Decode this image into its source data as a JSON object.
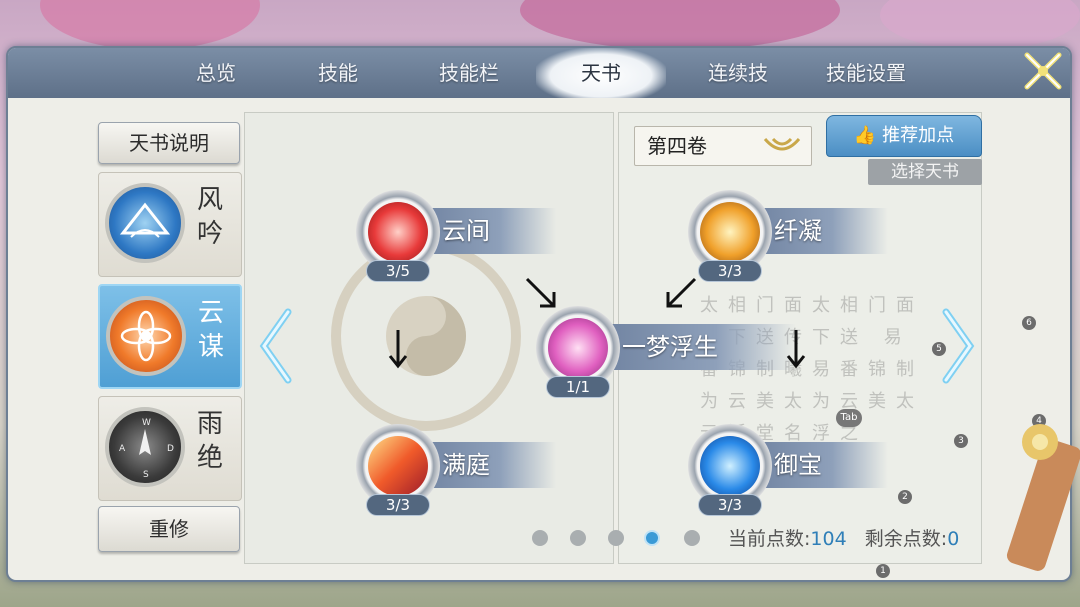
{
  "tabs": [
    {
      "label": "总览",
      "active": false
    },
    {
      "label": "技能",
      "active": false
    },
    {
      "label": "技能栏",
      "active": false
    },
    {
      "label": "天书",
      "active": true
    },
    {
      "label": "连续技",
      "active": false
    },
    {
      "label": "技能设置",
      "active": false
    }
  ],
  "sidebar": {
    "info_button": "天书说明",
    "books": [
      {
        "name_1": "风",
        "name_2": "吟",
        "icon": "wind-fan-icon",
        "active": false
      },
      {
        "name_1": "云",
        "name_2": "谋",
        "icon": "lotus-icon",
        "active": true
      },
      {
        "name_1": "雨",
        "name_2": "绝",
        "icon": "compass-icon",
        "active": false
      }
    ],
    "reset_button": "重修"
  },
  "skills": {
    "yunjian": {
      "name": "云间",
      "level": "3/5",
      "icon": "red-flower-icon"
    },
    "manting": {
      "name": "满庭",
      "level": "3/3",
      "icon": "flame-blade-icon"
    },
    "yimengfusheng": {
      "name": "一梦浮生",
      "level": "1/1",
      "icon": "pink-lotus-icon"
    },
    "qianning": {
      "name": "纤凝",
      "level": "3/3",
      "icon": "golden-flame-icon"
    },
    "yubao": {
      "name": "御宝",
      "level": "3/3",
      "icon": "blue-crystal-icon"
    }
  },
  "right_panel": {
    "volume_select": "第四卷",
    "recommend_button": "推荐加点",
    "select_book_button": "选择天书",
    "calligraphy": "太相门面太相门面 伪下送传下送 易番锦制曦易番锦制 为云美太为云美太 元活堂名浮之"
  },
  "pagination": {
    "count": 5,
    "active_index": 3
  },
  "points": {
    "current_label": "当前点数:",
    "current_value": "104",
    "remaining_label": "剩余点数:",
    "remaining_value": "0"
  },
  "overlay_badges": [
    "1",
    "2",
    "3",
    "4",
    "5",
    "6"
  ],
  "tab_hint": "Tab",
  "colors": {
    "tab_bar": "#6b7e97",
    "active_card": "#4f9fd4",
    "points_number": "#2f7fb8"
  }
}
